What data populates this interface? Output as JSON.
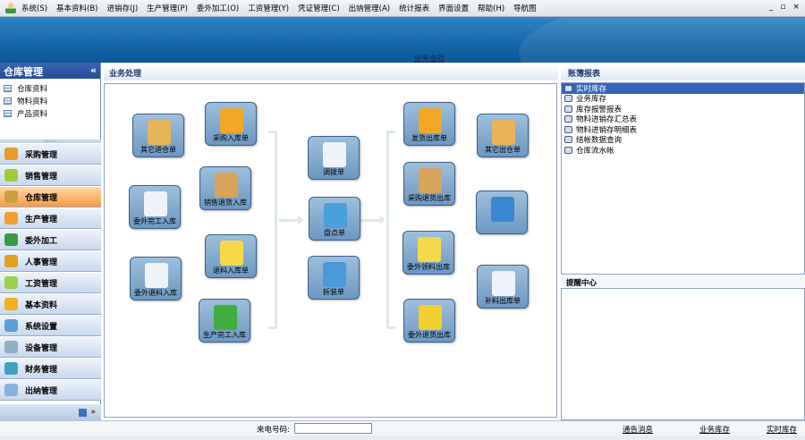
{
  "menu": [
    "系统(S)",
    "基本资料(B)",
    "进销存(J)",
    "生产管理(P)",
    "委外加工(O)",
    "工资管理(Y)",
    "凭证管理(C)",
    "出纳管理(A)",
    "统计报表",
    "界面设置",
    "帮助(H)",
    "导航图"
  ],
  "window_buttons": [
    "_",
    "▫",
    "×"
  ],
  "banner": {
    "find_link": "业务查找"
  },
  "left": {
    "title": "仓库管理",
    "collapse": "«",
    "items": [
      "仓库资料",
      "物料资料",
      "产品资料"
    ],
    "nav": [
      {
        "label": "采购管理",
        "color": "#e89a2c"
      },
      {
        "label": "销售管理",
        "color": "#9ccc3a"
      },
      {
        "label": "仓库管理",
        "color": "#c9a040",
        "active": true
      },
      {
        "label": "生产管理",
        "color": "#f0a030"
      },
      {
        "label": "委外加工",
        "color": "#3a9a4a"
      },
      {
        "label": "人事管理",
        "color": "#e0a020"
      },
      {
        "label": "工资管理",
        "color": "#9ad04a"
      },
      {
        "label": "基本资料",
        "color": "#f0b020"
      },
      {
        "label": "系统设置",
        "color": "#5aa0d8"
      },
      {
        "label": "设备管理",
        "color": "#90b0c8"
      },
      {
        "label": "财务管理",
        "color": "#40a0c0"
      },
      {
        "label": "出纳管理",
        "color": "#8ab0e0"
      }
    ],
    "bottom_more": "»"
  },
  "center": {
    "title": "业务处理",
    "tiles": [
      {
        "label": "其它进仓单",
        "icon": "boxes-in-icon",
        "color": "#e7b457"
      },
      {
        "label": "采购入库单",
        "icon": "folder-down-icon",
        "color": "#f2a727"
      },
      {
        "label": "委外完工入库",
        "icon": "doc-check-icon",
        "color": "#eef3fa"
      },
      {
        "label": "销售退货入库",
        "icon": "box-cancel-icon",
        "color": "#d9a35a"
      },
      {
        "label": "退料入库单",
        "icon": "folder-in-icon",
        "color": "#f5d94a"
      },
      {
        "label": "委外退料入库",
        "icon": "doc-cross-icon",
        "color": "#eef3fa"
      },
      {
        "label": "生产完工入库",
        "icon": "check-window-icon",
        "color": "#3fae3f"
      },
      {
        "label": "调拨单",
        "icon": "documents-icon",
        "color": "#eef3fa"
      },
      {
        "label": "盘点单",
        "icon": "calendar-icon",
        "color": "#4aa0d8"
      },
      {
        "label": "拆装单",
        "icon": "globe-link-icon",
        "color": "#4a9ad8"
      },
      {
        "label": "发货出库单",
        "icon": "folder-up-icon",
        "color": "#f2a727"
      },
      {
        "label": "采购退货出库",
        "icon": "box-cancel-icon",
        "color": "#d9a35a"
      },
      {
        "label": "委外领料出库",
        "icon": "folder-out-icon",
        "color": "#f5d94a"
      },
      {
        "label": "委外退货出库",
        "icon": "box-open-icon",
        "color": "#f2d030"
      },
      {
        "label": "其它出仓单",
        "icon": "boxes-out-icon",
        "color": "#e7b457"
      },
      {
        "label": "",
        "icon": "layers-transfer-icon",
        "color": "#3a86d0"
      },
      {
        "label": "补料出库单",
        "icon": "documents-icon",
        "color": "#eef3fa"
      }
    ]
  },
  "right": {
    "title": "账簿报表",
    "reports": [
      "实时库存",
      "业务库存",
      "库存报警报表",
      "物料进销存汇总表",
      "物料进销存明细表",
      "结帐数据查询",
      "仓库流水帐"
    ],
    "remind_title": "提醒中心"
  },
  "footer": {
    "phone_label": "来电号码:",
    "phone_value": "",
    "links": [
      "通告消息",
      "业务库存",
      "实时库存"
    ]
  }
}
